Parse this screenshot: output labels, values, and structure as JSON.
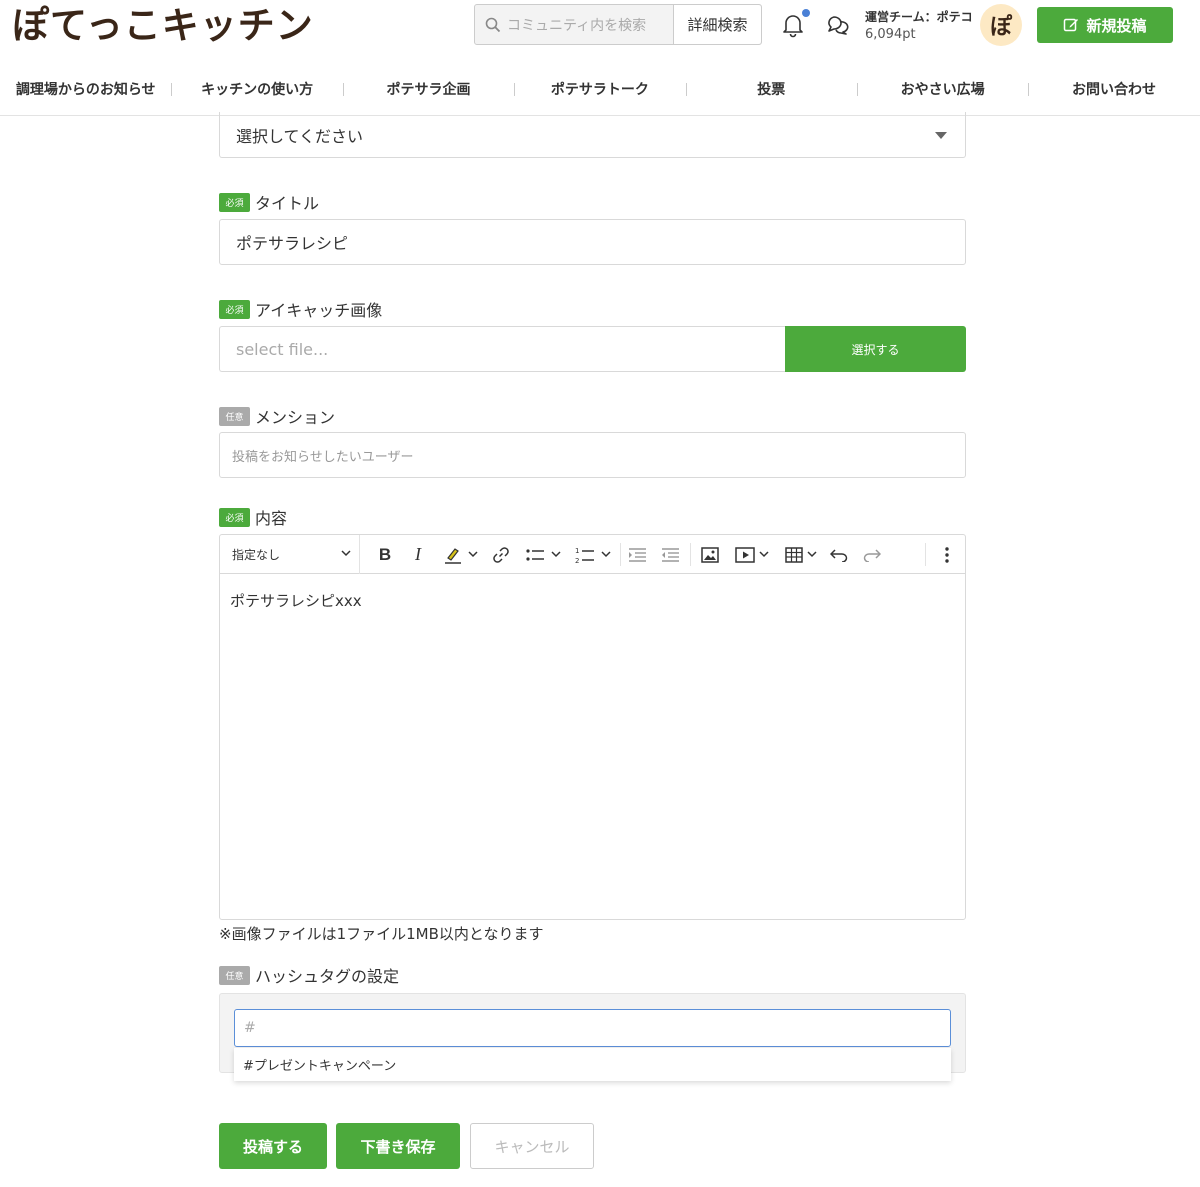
{
  "header": {
    "logo": "ぽてっこキッチン",
    "search_placeholder": "コミュニティ内を検索",
    "advanced_search": "詳細検索",
    "user_name": "運営チーム：ポテコ",
    "user_points": "6,094pt",
    "avatar_text": "ぽ",
    "new_post": "新規投稿"
  },
  "nav": {
    "items": [
      {
        "label": "調理場からのお知らせ"
      },
      {
        "label": "キッチンの使い方"
      },
      {
        "label": "ポテサラ企画"
      },
      {
        "label": "ポテサラトーク"
      },
      {
        "label": "投票"
      },
      {
        "label": "おやさい広場"
      },
      {
        "label": "お問い合わせ"
      }
    ]
  },
  "form": {
    "category_select": "選択してください",
    "required_badge": "必須",
    "optional_badge": "任意",
    "title_label": "タイトル",
    "title_value": "ポテサラレシピ",
    "image_label": "アイキャッチ画像",
    "file_placeholder": "select file...",
    "file_button": "選択する",
    "mention_label": "メンション",
    "mention_placeholder": "投稿をお知らせしたいユーザー",
    "content_label": "内容",
    "heading_select": "指定なし",
    "content_value": "ポテサラレシピxxx",
    "image_note": "※画像ファイルは1ファイル1MB以内となります",
    "hashtag_label": "ハッシュタグの設定",
    "hashtag_placeholder": "#",
    "hashtag_suggestion": "#プレゼントキャンペーン"
  },
  "actions": {
    "post": "投稿する",
    "draft": "下書き保存",
    "cancel": "キャンセル"
  },
  "colors": {
    "accent": "#4caa3c",
    "optional_badge": "#aaaaaa",
    "focus_border": "#5b8fd8",
    "notification_dot": "#4a80d6"
  }
}
